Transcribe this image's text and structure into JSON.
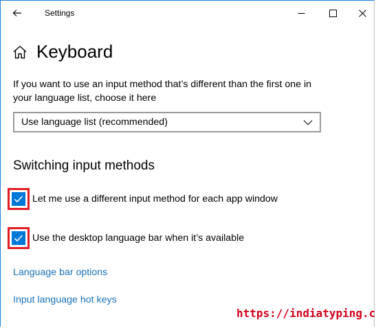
{
  "window": {
    "title": "Settings"
  },
  "icons": {
    "back": "back-arrow-icon",
    "minimize": "minimize-icon",
    "maximize": "maximize-icon",
    "close": "close-icon",
    "home": "home-icon",
    "chevron": "chevron-down-icon",
    "check": "checkmark-icon"
  },
  "page": {
    "title": "Keyboard",
    "description": "If you want to use an input method that’s different than the first one in your language list, choose it here",
    "input_method_select": {
      "value": "Use language list (recommended)"
    }
  },
  "switching": {
    "title": "Switching input methods",
    "options": [
      {
        "label": "Let me use a different input method for each app window",
        "checked": true
      },
      {
        "label": "Use the desktop language bar when it’s available",
        "checked": true
      }
    ]
  },
  "links": {
    "language_bar_options": "Language bar options",
    "input_language_hot_keys": "Input language hot keys"
  },
  "watermark": "https://indiatyping.com",
  "colors": {
    "accent": "#0078d7",
    "link": "#1a73b8",
    "highlight": "#e01b24",
    "watermark": "#d0021b"
  }
}
